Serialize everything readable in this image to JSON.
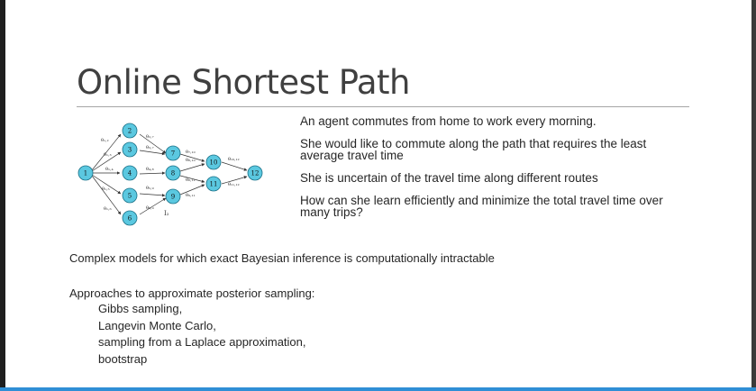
{
  "slide": {
    "title": "Online Shortest Path",
    "bullets": [
      "An agent commutes from home to work every morning.",
      "She would like to commute along the path that requires the least average travel time",
      "She is uncertain of the travel time along different routes",
      "How can she learn efficiently and minimize the total travel time over many trips?"
    ],
    "complex_models": "Complex models for which exact Bayesian inference is computationally intractable",
    "approaches_heading": "Approaches to approximate posterior sampling:",
    "approaches": [
      "Gibbs sampling,",
      "Langevin Monte Carlo,",
      "sampling from a Laplace approximation,",
      "bootstrap"
    ]
  },
  "diagram": {
    "nodes": [
      "1",
      "2",
      "3",
      "4",
      "5",
      "6",
      "7",
      "8",
      "9",
      "10",
      "11",
      "12"
    ],
    "node_fill": "#5bc8e0",
    "node_stroke": "#1a6f86",
    "edge_color": "#333333"
  },
  "colors": {
    "accent_bar": "#2f8fd6",
    "title": "#404040"
  }
}
